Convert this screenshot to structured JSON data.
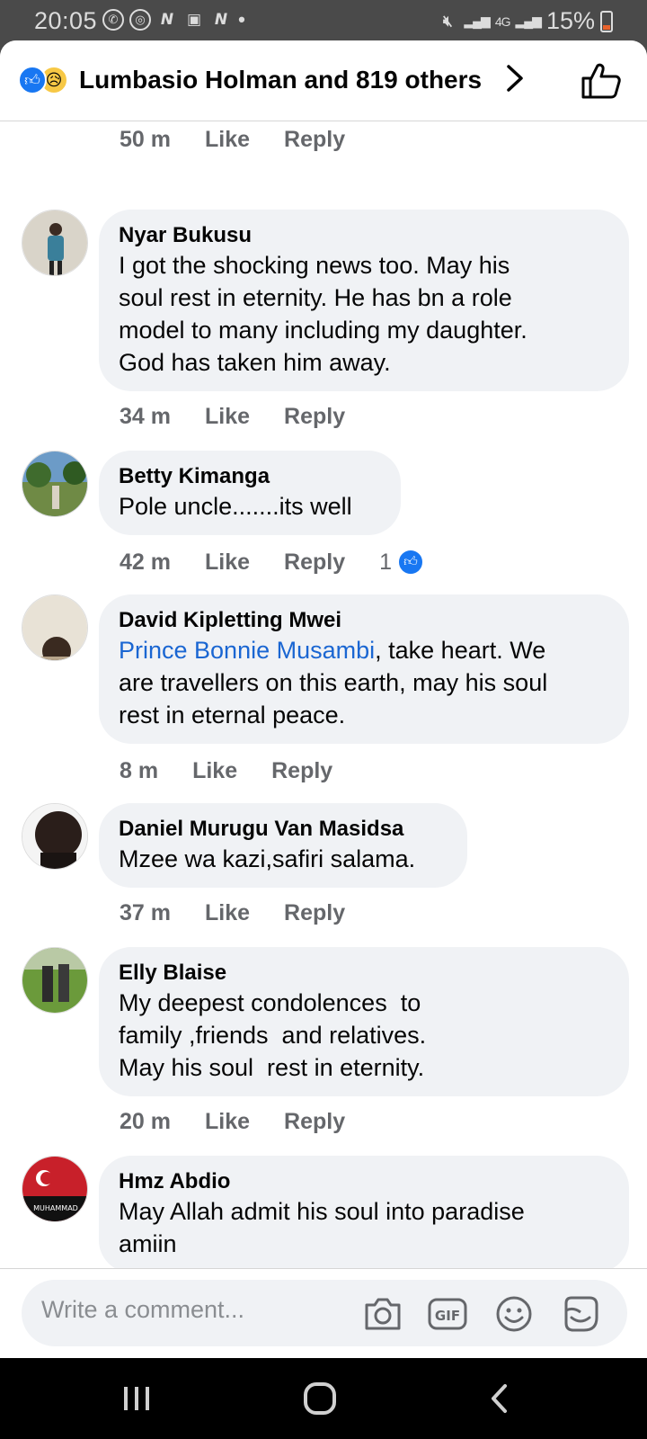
{
  "status_bar": {
    "time": "20:05",
    "left_icons": [
      "whatsapp-icon",
      "notification-icon",
      "news-icon",
      "facebook-icon",
      "news-icon",
      "dot-icon"
    ],
    "network": "4G",
    "battery": "15%"
  },
  "header": {
    "reactions_text": "Lumbasio Holman and 819 others",
    "reaction_types": [
      "like",
      "sad"
    ]
  },
  "top_actions": {
    "time": "50 m",
    "like": "Like",
    "reply": "Reply"
  },
  "comments": [
    {
      "author": "Nyar Bukusu",
      "lines": [
        "I got the shocking news too. May his",
        "soul rest in eternity. He has bn a role",
        "model to many including my daughter.",
        "God has taken him away."
      ],
      "time": "34 m",
      "like": "Like",
      "reply": "Reply"
    },
    {
      "author": "Betty Kimanga",
      "lines": [
        "Pole uncle.......its well"
      ],
      "time": "42 m",
      "like": "Like",
      "reply": "Reply",
      "reaction_count": "1"
    },
    {
      "author": "David Kipletting Mwei",
      "mention": "Prince Bonnie Musambi",
      "lines": [
        ", take heart. We",
        "are travellers on this earth, may his soul",
        "rest in eternal peace."
      ],
      "time": "8 m",
      "like": "Like",
      "reply": "Reply"
    },
    {
      "author": "Daniel Murugu Van Masidsa",
      "lines": [
        "Mzee wa kazi,safiri salama."
      ],
      "time": "37 m",
      "like": "Like",
      "reply": "Reply"
    },
    {
      "author": "Elly Blaise",
      "lines": [
        "My deepest condolences  to",
        "family ,friends  and relatives.",
        "May his soul  rest in eternity."
      ],
      "time": "20 m",
      "like": "Like",
      "reply": "Reply"
    },
    {
      "author": "Hmz Abdio",
      "lines": [
        "May Allah admit his soul into paradise",
        "amiin"
      ],
      "avatar_text": "MUHAMMAD"
    }
  ],
  "composer": {
    "placeholder": "Write a comment...",
    "icons": [
      "camera-icon",
      "gif-icon",
      "emoji-icon",
      "sticker-icon"
    ],
    "gif_label": "GIF"
  }
}
